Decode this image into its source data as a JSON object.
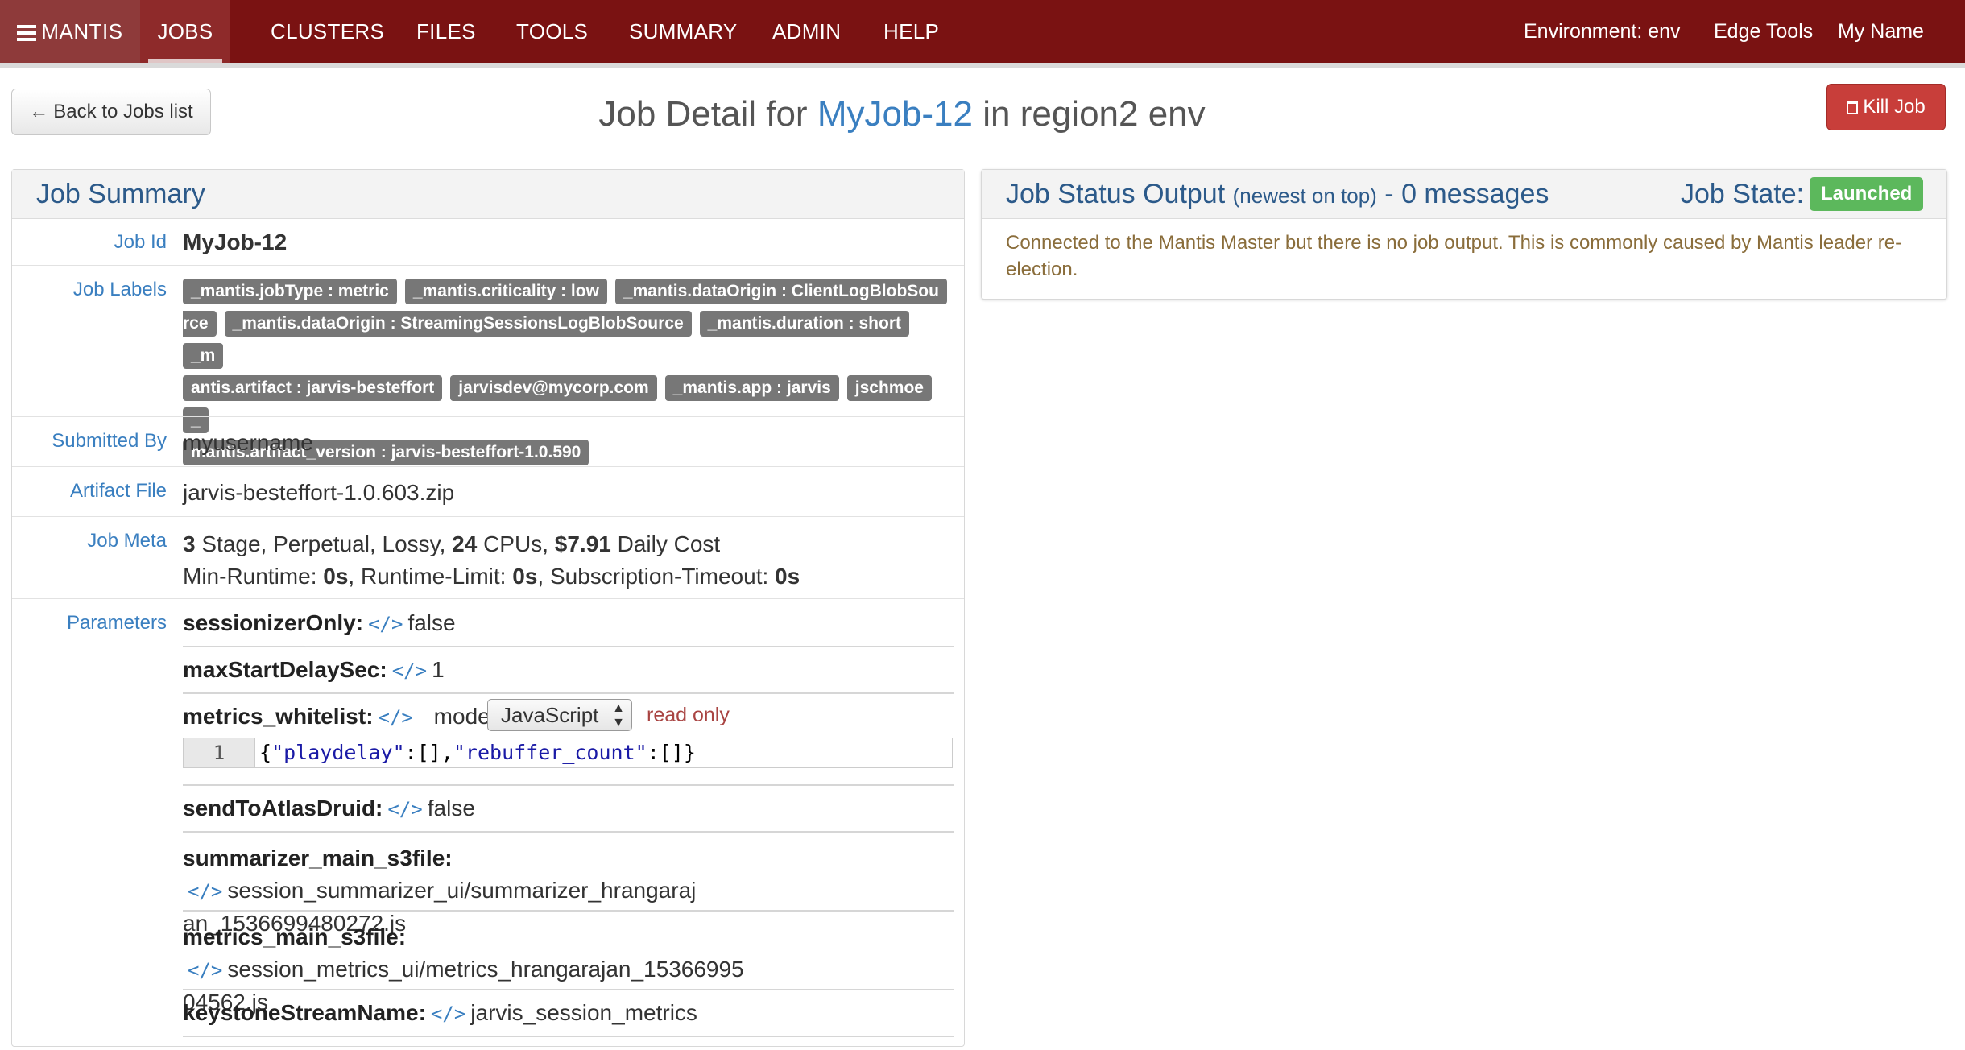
{
  "nav": {
    "brand": "MANTIS",
    "items": [
      "JOBS",
      "CLUSTERS",
      "FILES",
      "TOOLS",
      "SUMMARY",
      "ADMIN",
      "HELP"
    ],
    "active": "JOBS",
    "environment": "Environment: env",
    "edge_tools": "Edge Tools",
    "user": "My Name"
  },
  "topbar": {
    "back_label": "Back to Jobs list",
    "title_prefix": "Job Detail for",
    "job_name": "MyJob-12",
    "title_suffix": "in region2 env",
    "kill_label": "Kill Job"
  },
  "summary": {
    "title": "Job Summary",
    "job_id_key": "Job Id",
    "job_id": "MyJob-12",
    "labels_key": "Job Labels",
    "labels": [
      "_mantis.jobType : metric",
      "_mantis.criticality : low",
      "_mantis.dataOrigin : ClientLogBlobSou",
      "rce",
      "_mantis.dataOrigin : StreamingSessionsLogBlobSource",
      "_mantis.duration : short",
      "_m",
      "antis.artifact : jarvis-besteffort",
      "jarvisdev@mycorp.com",
      "_mantis.app : jarvis",
      "jschmoe",
      "_",
      "mantis.artifact_version : jarvis-besteffort-1.0.590"
    ],
    "submitted_key": "Submitted By",
    "submitted": "myusername",
    "artifact_key": "Artifact File",
    "artifact": "jarvis-besteffort-1.0.603.zip",
    "meta_key": "Job Meta",
    "meta": {
      "stages": "3",
      "stage_text": " Stage, Perpetual, Lossy, ",
      "cpus": "24",
      "cpu_text": " CPUs, ",
      "cost": "$7.91",
      "cost_text": " Daily Cost",
      "min_label": "Min-Runtime: ",
      "min": "0s",
      "limit_label": ", Runtime-Limit: ",
      "limit": "0s",
      "sub_label": ", Subscription-Timeout: ",
      "sub": "0s"
    },
    "params_key": "Parameters",
    "params": {
      "p1_name": "sessionizerOnly:",
      "p1_val": "false",
      "p2_name": "maxStartDelaySec:",
      "p2_val": "1",
      "p3_name": "metrics_whitelist:",
      "p3_mode_label": "mode:",
      "p3_mode": "JavaScript",
      "p3_readonly": "read only",
      "p3_line": "1",
      "p3_code_a": "{",
      "p3_code_b": "\"playdelay\"",
      "p3_code_c": ":[],",
      "p3_code_d": "\"rebuffer_count\"",
      "p3_code_e": ":[]}",
      "p4_name": "sendToAtlasDruid:",
      "p4_val": "false",
      "p5_name": "summarizer_main_s3file:",
      "p5_val1": "session_summarizer_ui/summarizer_hrangaraj",
      "p5_val2": "an_1536699480272.js",
      "p6_name": "metrics_main_s3file:",
      "p6_val1": "session_metrics_ui/metrics_hrangarajan_15366995",
      "p6_val2": "04562.js",
      "p7_name": "keystoneStreamName:",
      "p7_val": "jarvis_session_metrics"
    },
    "code_icon": "</>"
  },
  "status": {
    "title": "Job Status Output",
    "subtitle": "(newest on top)",
    "count": "- 0 messages",
    "state_label": "Job State:",
    "state": "Launched",
    "state_color": "#5cb85c",
    "message": "Connected to the Mantis Master but there is no job output. This is commonly caused by Mantis leader re-election."
  }
}
